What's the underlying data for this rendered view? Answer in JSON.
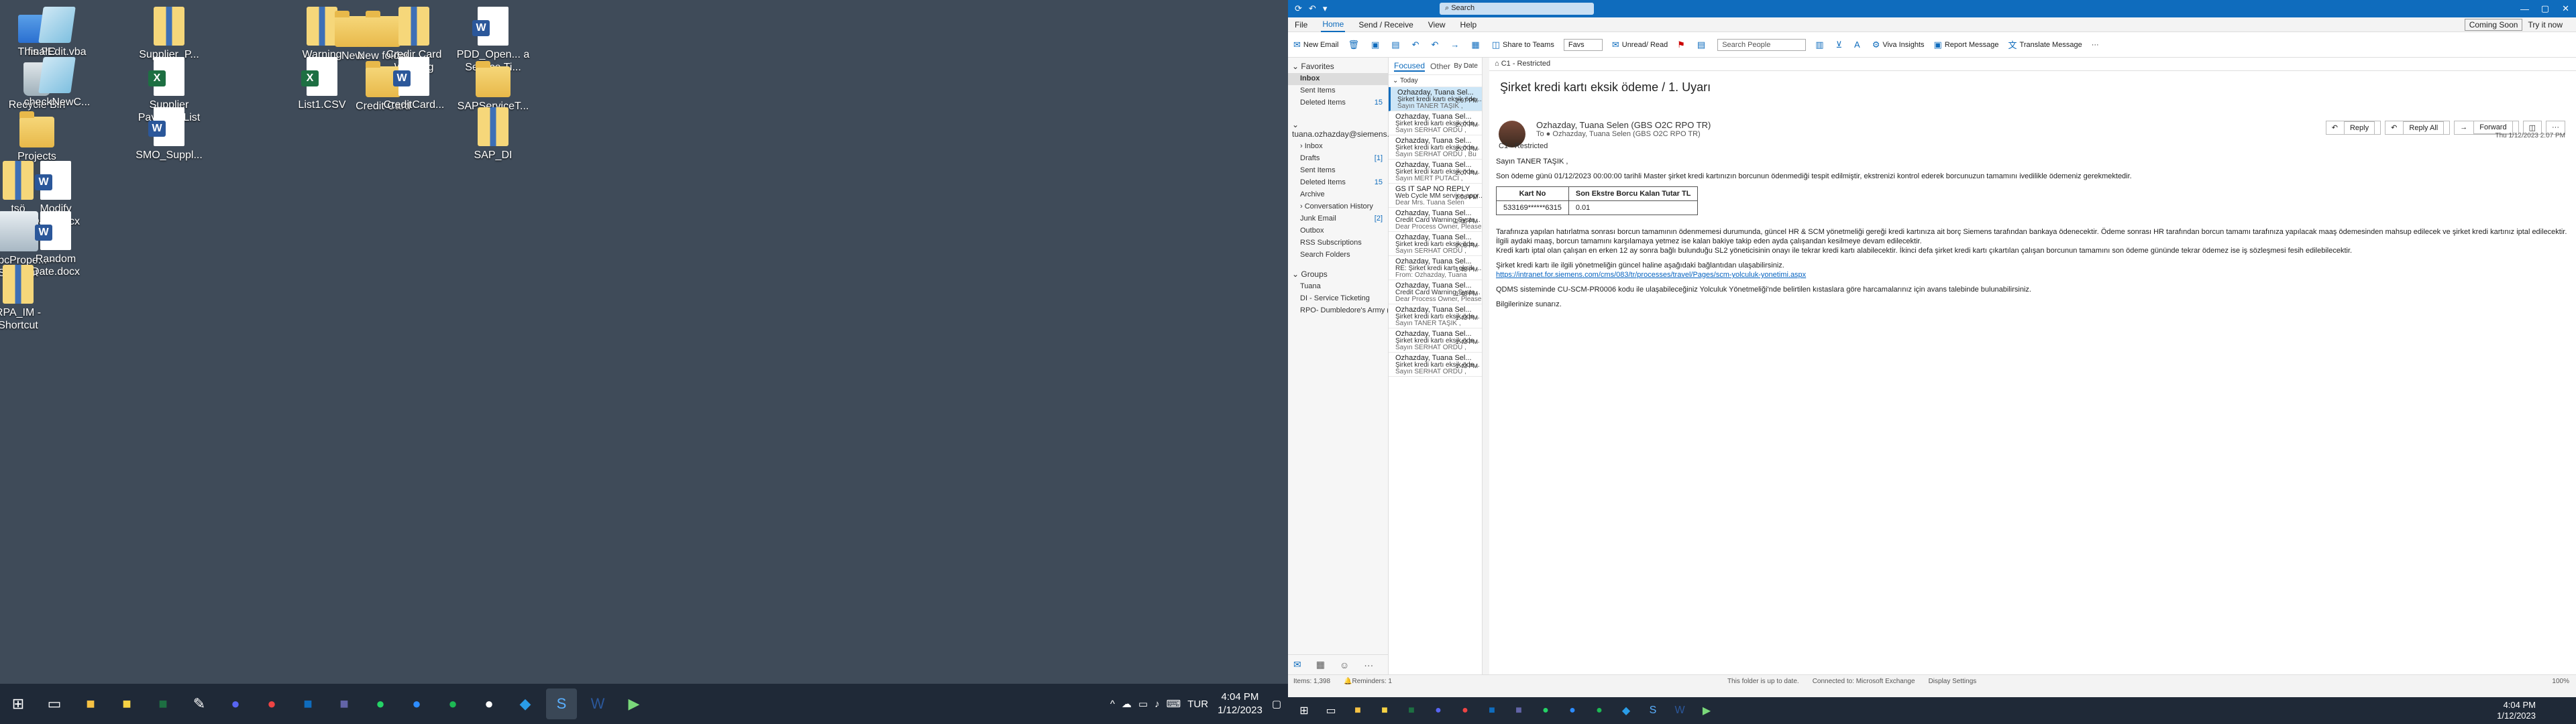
{
  "desktop": {
    "icons": [
      {
        "label": "This PC"
      },
      {
        "label": "finalEdit.vba"
      },
      {
        "label": "Supplier_P..."
      },
      {
        "label": "Warning"
      },
      {
        "label": "New"
      },
      {
        "label": "New folder"
      },
      {
        "label": "Credir Card Warning"
      },
      {
        "label": "PDD_Open... a Service Ti..."
      },
      {
        "label": "Recycle Bin"
      },
      {
        "label": "checkNewC..."
      },
      {
        "label": "Supplier Payment List"
      },
      {
        "label": "List1.CSV"
      },
      {
        "label": "Credit Card"
      },
      {
        "label": "CreditCard..."
      },
      {
        "label": "SAPServiceT..."
      },
      {
        "label": "Projects"
      },
      {
        "label": "SMO_Suppl..."
      },
      {
        "label": "SAP_DI"
      },
      {
        "label": "tsö"
      },
      {
        "label": "Modify Date.docx"
      },
      {
        "label": "NwbcPrope... - Shortcut"
      },
      {
        "label": "Random Date.docx"
      },
      {
        "label": "RPA_IM - Shortcut"
      }
    ]
  },
  "taskbar": {
    "lang": "TUR",
    "time": "4:04 PM",
    "date": "1/12/2023"
  },
  "outlook": {
    "search_placeholder": "Search",
    "coming_soon": "Coming Soon",
    "try_it_now": "Try it now",
    "menu": [
      "File",
      "Home",
      "Send / Receive",
      "View",
      "Help"
    ],
    "ribbon": {
      "new_email": "New Email",
      "share_teams": "Share to Teams",
      "favs": "Favs",
      "unread_read": "Unread/ Read",
      "search_people": "Search People",
      "viva": "Viva Insights",
      "report": "Report Message",
      "translate": "Translate Message"
    },
    "nav": {
      "favorites": "Favorites",
      "fav_items": [
        {
          "label": "Inbox",
          "count": ""
        },
        {
          "label": "Sent Items",
          "count": ""
        },
        {
          "label": "Deleted Items",
          "count": "15"
        }
      ],
      "account": "tuana.ozhazday@siemens....",
      "acc_items": [
        {
          "label": "Inbox",
          "count": ""
        },
        {
          "label": "Drafts",
          "count": "[1]"
        },
        {
          "label": "Sent Items",
          "count": ""
        },
        {
          "label": "Deleted Items",
          "count": "15"
        },
        {
          "label": "Archive",
          "count": ""
        },
        {
          "label": "Conversation History",
          "count": ""
        },
        {
          "label": "Junk Email",
          "count": "[2]"
        },
        {
          "label": "Outbox",
          "count": ""
        },
        {
          "label": "RSS Subscriptions",
          "count": ""
        },
        {
          "label": "Search Folders",
          "count": ""
        }
      ],
      "groups": "Groups",
      "group_items": [
        {
          "label": "Tuana"
        },
        {
          "label": "DI - Service Ticketing"
        },
        {
          "label": "RPO- Dumbledore's Army ( De..."
        }
      ]
    },
    "list": {
      "focused": "Focused",
      "other": "Other",
      "by_date": "By Date",
      "today": "Today",
      "messages": [
        {
          "sender": "Ozhazday, Tuana Sel...",
          "subject": "Şirket kredi kartı eksik öde...",
          "preview": "Sayın TANER TAŞIK ,",
          "time": "2:07 PM"
        },
        {
          "sender": "Ozhazday, Tuana Sel...",
          "subject": "Şirket kredi kartı eksik öde...",
          "preview": "Sayın SERHAT ORDU ,",
          "time": "2:07 PM"
        },
        {
          "sender": "Ozhazday, Tuana Sel...",
          "subject": "Şirket kredi kartı eksik öde...",
          "preview": "Sayın SERHAT ORDU , Bu",
          "time": "2:07 PM"
        },
        {
          "sender": "Ozhazday, Tuana Sel...",
          "subject": "Şirket kredi kartı eksik öde...",
          "preview": "Sayın MERT PUTACI ,",
          "time": "2:07 PM"
        },
        {
          "sender": "GS IT SAP NO REPLY",
          "subject": "Web Cycle MM service appr...",
          "preview": "Dear Mrs. Tuana Selen",
          "time": "2:06 PM"
        },
        {
          "sender": "Ozhazday, Tuana Sel...",
          "subject": "Credit Card Warning Syste...",
          "preview": "Dear Process Owner, Please",
          "time": "2:05 PM"
        },
        {
          "sender": "Ozhazday, Tuana Sel...",
          "subject": "Şirket kredi kartı eksik öde...",
          "preview": "Sayın SERHAT ORDU ,",
          "time": "2:05 PM"
        },
        {
          "sender": "Ozhazday, Tuana Sel...",
          "subject": "RE: Şirket kredi kartı eksik ...",
          "preview": "From: Ozhazday, Tuana",
          "time": "1:48 PM"
        },
        {
          "sender": "Ozhazday, Tuana Sel...",
          "subject": "Credit Card Warning Syste...",
          "preview": "Dear Process Owner, Please",
          "time": "1:43 PM"
        },
        {
          "sender": "Ozhazday, Tuana Sel...",
          "subject": "Şirket kredi kartı eksik öde...",
          "preview": "Sayın TANER TAŞIK ,",
          "time": "1:43 PM"
        },
        {
          "sender": "Ozhazday, Tuana Sel...",
          "subject": "Şirket kredi kartı eksik öde...",
          "preview": "Sayın SERHAT ORDU ,",
          "time": "1:43 PM"
        },
        {
          "sender": "Ozhazday, Tuana Sel...",
          "subject": "Şirket kredi kartı eksik öde...",
          "preview": "Sayın SERHAT ORDU ,",
          "time": "1:43 PM"
        }
      ]
    },
    "reader": {
      "restricted": "C1 - Restricted",
      "subject": "Şirket kredi kartı eksik ödeme / 1. Uyarı",
      "from": "Ozhazday, Tuana Selen (GBS O2C RPO TR)",
      "to": "Ozhazday, Tuana Selen (GBS O2C RPO TR)",
      "to_prefix": "To",
      "label": "C1 - Restricted",
      "reply": "Reply",
      "reply_all": "Reply All",
      "forward": "Forward",
      "date": "Thu 1/12/2023 2:07 PM",
      "greeting": "Sayın TANER TAŞIK ,",
      "p1": "Son ödeme günü 01/12/2023 00:00:00 tarihli Master şirket kredi kartınızın borcunun ödenmediği tespit edilmiştir, ekstrenizi kontrol ederek borcunuzun tamamını ivedilikle ödemeniz gerekmektedir.",
      "table_headers": [
        "Kart No",
        "Son Ekstre Borcu Kalan Tutar TL"
      ],
      "table_row": [
        "533169******6315",
        "0.01"
      ],
      "p2": "Tarafınıza yapılan hatırlatma sonrası borcun tamamının ödenmemesi durumunda, güncel HR & SCM yönetmeliği gereği kredi kartınıza ait borç Siemens tarafından bankaya ödenecektir. Ödeme sonrası HR tarafından borcun tamamı tarafınıza yapılacak maaş ödemesinden mahsup edilecek ve şirket kredi kartınız iptal edilecektir. İlgili aydaki maaş, borcun tamamını karşılamaya yetmez ise kalan bakiye takip eden ayda çalışandan kesilmeye devam edilecektir.",
      "p3": "Kredi kartı iptal olan çalışan en erken 12 ay sonra bağlı bulunduğu SL2 yöneticisinin onayı ile tekrar kredi kartı alabilecektir. İkinci defa şirket kredi kartı çıkartılan çalışan borcunun tamamını son ödeme gününde tekrar ödemez ise iş sözleşmesi fesih edilebilecektir.",
      "p4": "Şirket kredi kartı ile ilgili yönetmeliğin güncel haline aşağıdaki bağlantıdan ulaşabilirsiniz.",
      "link": "https://intranet.for.siemens.com/cms/083/tr/processes/travel/Pages/scm-yolculuk-yonetimi.aspx",
      "p5": "QDMS sisteminde CU-SCM-PR0006 kodu ile ulaşabileceğiniz Yolculuk Yönetmeliği'nde belirtilen kıstaslara göre harcamalarınız için avans talebinde bulunabilirsiniz.",
      "p6": "Bilgilerinize sunarız."
    },
    "status": {
      "items": "Items: 1,398",
      "reminders": "Reminders: 1",
      "uptodate": "This folder is up to date.",
      "connected": "Connected to: Microsoft Exchange",
      "display": "Display Settings",
      "zoom": "100%"
    }
  }
}
